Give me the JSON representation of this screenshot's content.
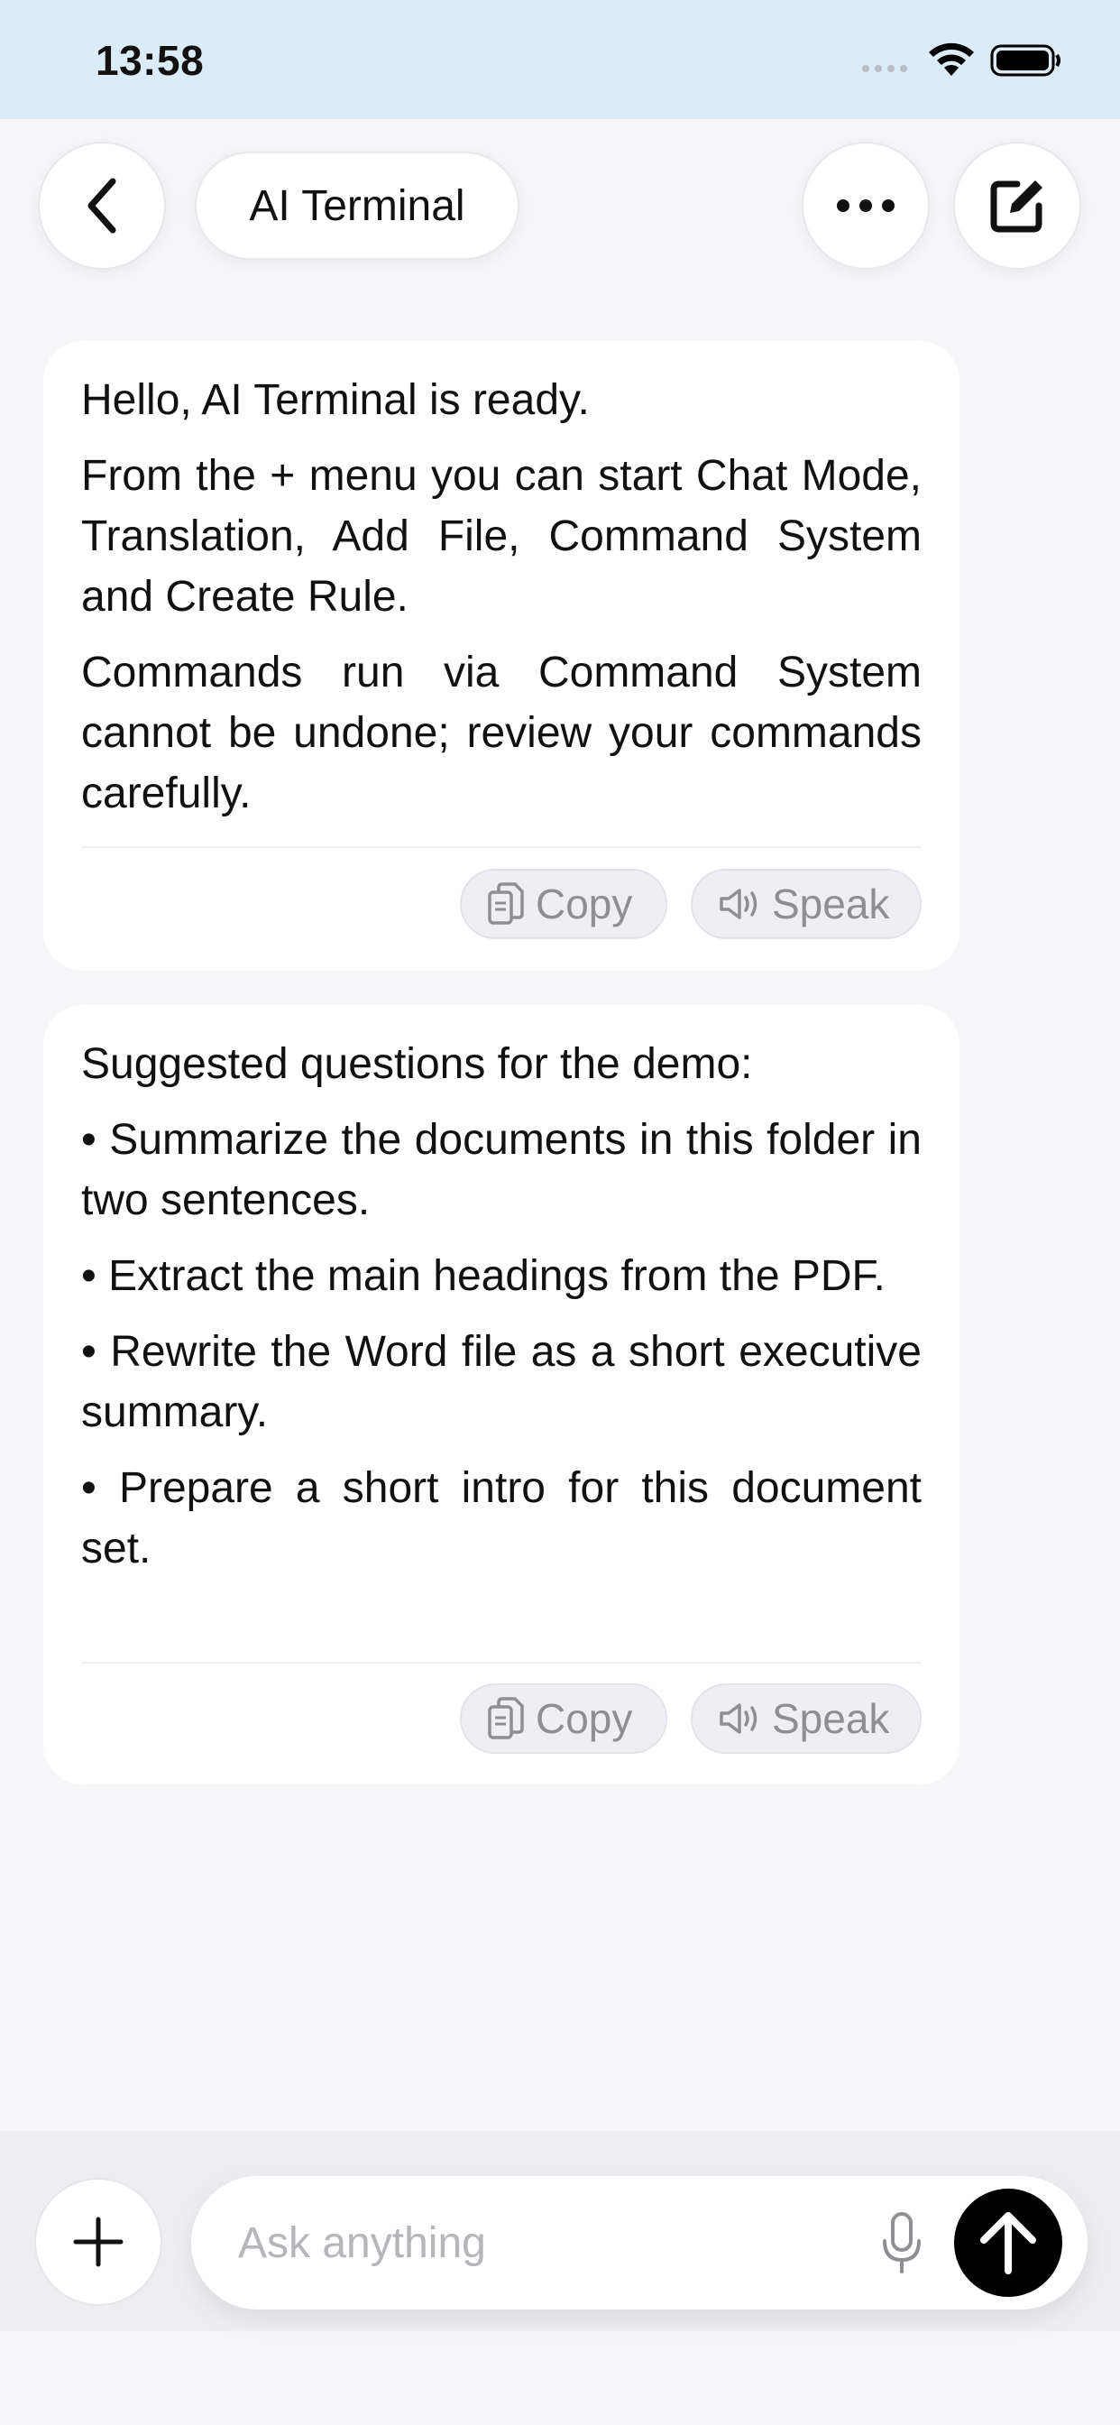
{
  "status_bar": {
    "time": "13:58"
  },
  "header": {
    "title": "AI Terminal"
  },
  "messages": [
    {
      "paragraphs": [
        "Hello, AI Terminal is ready.",
        "From the + menu you can start Chat Mode, Translation, Add File, Command System and Create Rule.",
        "Commands run via Command System cannot be undone; review your com­mands carefully."
      ],
      "copy_label": "Copy",
      "speak_label": "Speak"
    },
    {
      "paragraphs": [
        "Suggested questions for the demo:",
        "• Summarize the documents in this folder in two sentences.",
        "• Extract the main headings from the PDF.",
        "• Rewrite the Word file as a short executive summary.",
        "• Prepare a short intro for this document set."
      ],
      "copy_label": "Copy",
      "speak_label": "Speak"
    }
  ],
  "composer": {
    "placeholder": "Ask anything",
    "value": ""
  },
  "icons": {
    "back": "chevron-left-icon",
    "more": "ellipsis-icon",
    "compose": "compose-icon",
    "copy": "copy-icon",
    "speak": "speaker-icon",
    "add": "plus-icon",
    "mic": "microphone-icon",
    "send": "arrow-up-icon"
  },
  "colors": {
    "status_bar_bg": "#dcebf8",
    "page_bg": "#f6f6f9",
    "send_button": "#000000"
  }
}
